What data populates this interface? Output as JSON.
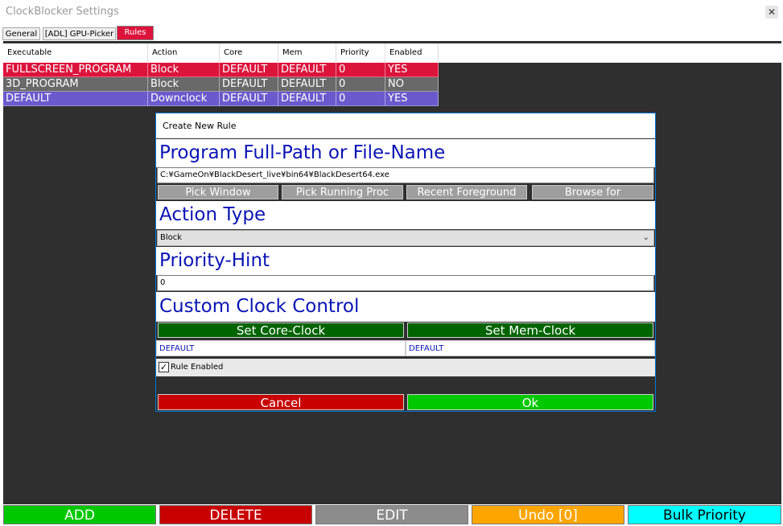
{
  "window": {
    "title": "ClockBlocker Settings",
    "close_glyph": "✕"
  },
  "tabs": [
    {
      "label": "General"
    },
    {
      "label": "[ADL] GPU-Picker"
    },
    {
      "label": "Rules"
    }
  ],
  "grid": {
    "columns": [
      "Executable",
      "Action",
      "Core",
      "Mem",
      "Priority",
      "Enabled"
    ],
    "rows": [
      {
        "cells": [
          "FULLSCREEN_PROGRAM",
          "Block",
          "DEFAULT",
          "DEFAULT",
          "0",
          "YES"
        ],
        "color": "#dc143c"
      },
      {
        "cells": [
          "3D_PROGRAM",
          "Block",
          "DEFAULT",
          "DEFAULT",
          "0",
          "NO"
        ],
        "color": "#696969"
      },
      {
        "cells": [
          "DEFAULT",
          "Downclock",
          "DEFAULT",
          "DEFAULT",
          "0",
          "YES"
        ],
        "color": "#6a5acd"
      }
    ]
  },
  "dialog": {
    "title": "Create New Rule",
    "path_heading": "Program Full-Path or File-Name",
    "path_value": "C:¥GameOn¥BlackDesert_live¥bin64¥BlackDesert64.exe",
    "pick_buttons": [
      "Pick Window",
      "Pick Running Proc",
      "Recent Foreground",
      "Browse for"
    ],
    "action_heading": "Action Type",
    "action_value": "Block",
    "priority_heading": "Priority-Hint",
    "priority_value": "0",
    "clock_heading": "Custom Clock Control",
    "core_button": "Set Core-Clock",
    "mem_button": "Set Mem-Clock",
    "core_value": "DEFAULT",
    "mem_value": "DEFAULT",
    "rule_enabled_label": "Rule Enabled",
    "rule_enabled_mark": "✓",
    "cancel_label": "Cancel",
    "ok_label": "Ok"
  },
  "bottom_buttons": [
    {
      "label": "ADD",
      "bg": "#00c800",
      "fg": "#ffffff"
    },
    {
      "label": "DELETE",
      "bg": "#c80000",
      "fg": "#ffffff"
    },
    {
      "label": "EDIT",
      "bg": "#8c8c8c",
      "fg": "#ffffff"
    },
    {
      "label": "Undo [0]",
      "bg": "#ffa500",
      "fg": "#ffffff"
    },
    {
      "label": "Bulk Priority",
      "bg": "#00ffff",
      "fg": "#000000"
    }
  ]
}
